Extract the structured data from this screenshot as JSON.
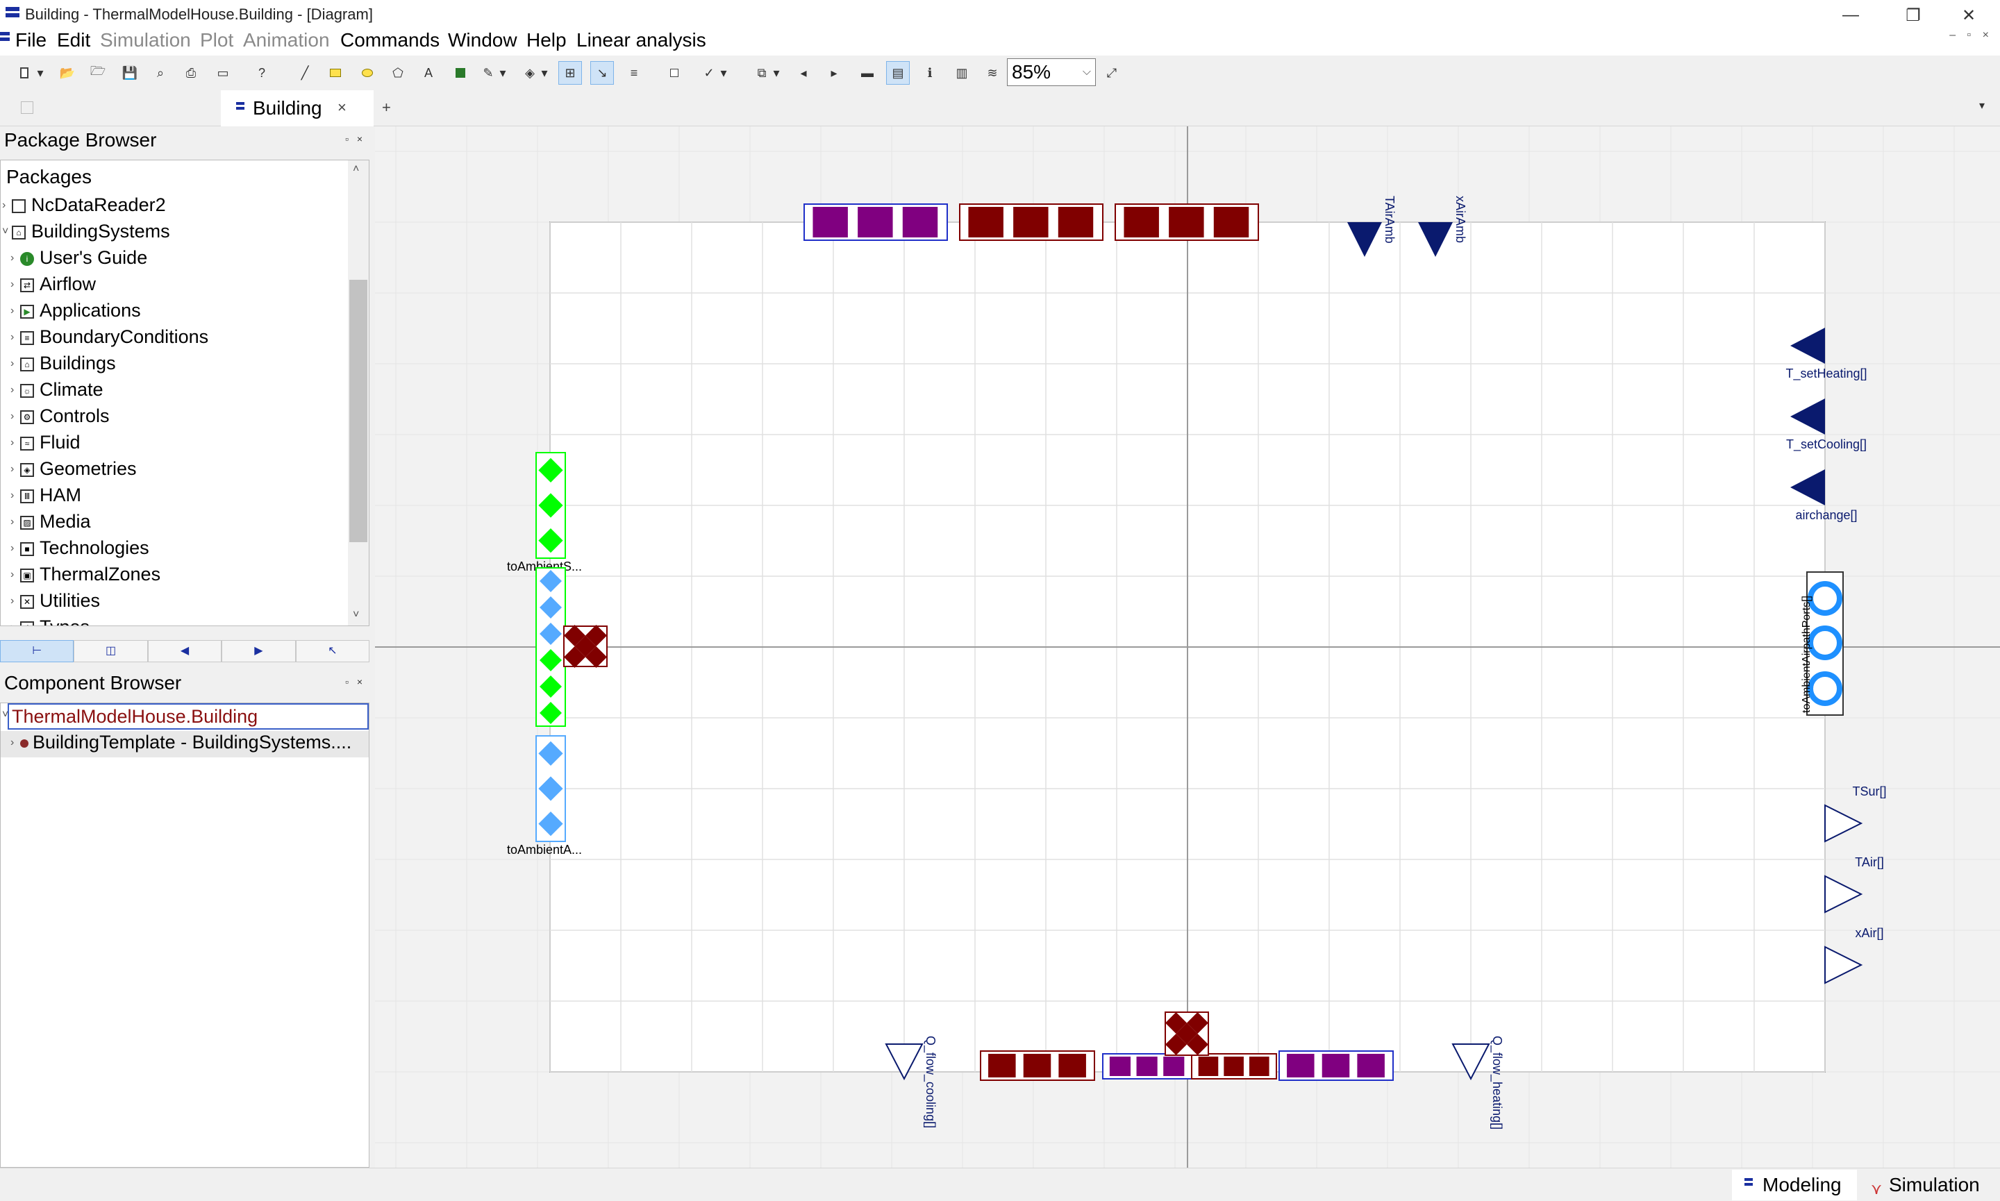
{
  "window": {
    "title": "Building - ThermalModelHouse.Building  - [Diagram]",
    "minimize": "—",
    "restore": "❐",
    "close": "✕"
  },
  "menu": {
    "items": [
      {
        "label": "File",
        "enabled": true
      },
      {
        "label": "Edit",
        "enabled": true
      },
      {
        "label": "Simulation",
        "enabled": false
      },
      {
        "label": "Plot",
        "enabled": false
      },
      {
        "label": "Animation",
        "enabled": false
      },
      {
        "label": "Commands",
        "enabled": true
      },
      {
        "label": "Window",
        "enabled": true
      },
      {
        "label": "Help",
        "enabled": true
      },
      {
        "label": "Linear analysis",
        "enabled": true
      }
    ],
    "mdi_controls": "– ▫ ×"
  },
  "toolbar": {
    "zoom": "85%",
    "zoom_caret": "⌵"
  },
  "tabs": {
    "active": "Building",
    "close": "×",
    "add": "+",
    "menu": "▾"
  },
  "package_browser": {
    "title": "Package Browser",
    "controls": "▫ ×",
    "header": "Packages",
    "items": [
      {
        "label": "NcDataReader2",
        "icon": "package-icon",
        "level": 0,
        "glyph": ""
      },
      {
        "label": "BuildingSystems",
        "icon": "package-icon",
        "level": 0,
        "glyph": "⌂",
        "expanded": true
      },
      {
        "label": "User's Guide",
        "icon": "info-icon",
        "level": 1,
        "glyph": "i"
      },
      {
        "label": "Airflow",
        "icon": "airflow-icon",
        "level": 1,
        "glyph": "⇄"
      },
      {
        "label": "Applications",
        "icon": "play-icon",
        "level": 1,
        "glyph": "▶"
      },
      {
        "label": "BoundaryConditions",
        "icon": "boundary-icon",
        "level": 1,
        "glyph": "≡"
      },
      {
        "label": "Buildings",
        "icon": "building-icon",
        "level": 1,
        "glyph": "⌂"
      },
      {
        "label": "Climate",
        "icon": "climate-icon",
        "level": 1,
        "glyph": "☼"
      },
      {
        "label": "Controls",
        "icon": "controls-icon",
        "level": 1,
        "glyph": "⚙"
      },
      {
        "label": "Fluid",
        "icon": "fluid-icon",
        "level": 1,
        "glyph": "≈"
      },
      {
        "label": "Geometries",
        "icon": "geometry-icon",
        "level": 1,
        "glyph": "◈"
      },
      {
        "label": "HAM",
        "icon": "ham-icon",
        "level": 1,
        "glyph": "Ⅲ"
      },
      {
        "label": "Media",
        "icon": "media-icon",
        "level": 1,
        "glyph": "▨"
      },
      {
        "label": "Technologies",
        "icon": "technology-icon",
        "level": 1,
        "glyph": "■"
      },
      {
        "label": "ThermalZones",
        "icon": "zone-icon",
        "level": 1,
        "glyph": "▣"
      },
      {
        "label": "Utilities",
        "icon": "utilities-icon",
        "level": 1,
        "glyph": "✕"
      },
      {
        "label": "Types",
        "icon": "types-icon",
        "level": 1,
        "glyph": "f"
      }
    ],
    "nav": [
      "⊢",
      "◫",
      "◀",
      "▶",
      "↖"
    ]
  },
  "component_browser": {
    "title": "Component Browser",
    "controls": "▫ ×",
    "root": "ThermalModelHouse.Building",
    "child": "BuildingTemplate - BuildingSystems...."
  },
  "diagram": {
    "labels": {
      "TAirAmb": "TAirAmb",
      "xAirAmb": "xAirAmb",
      "T_setHeating": "T_setHeating[]",
      "T_setCooling": "T_setCooling[]",
      "airchange": "airchange[]",
      "toAmbientAirpathPorts": "toAmbientAirpathPorts[]",
      "toAmbientS": "toAmbientS...",
      "toAmbientA": "toAmbientA...",
      "TSur": "TSur[]",
      "TAir": "TAir[]",
      "xAir": "xAir[]",
      "Q_flow_cooling": "Q_flow_cooling[]",
      "Q_flow_heating": "Q_flow_heating[]"
    },
    "colors": {
      "connector_navy": "#0a1a6e",
      "heat_port_red": "#800000",
      "moisture_purple": "#800080",
      "green_port": "#00ff00",
      "blue_port": "#55aaff",
      "airpath_blue": "#1e90ff"
    }
  },
  "status": {
    "modes": [
      {
        "label": "Modeling",
        "active": true
      },
      {
        "label": "Simulation",
        "active": false
      }
    ]
  }
}
